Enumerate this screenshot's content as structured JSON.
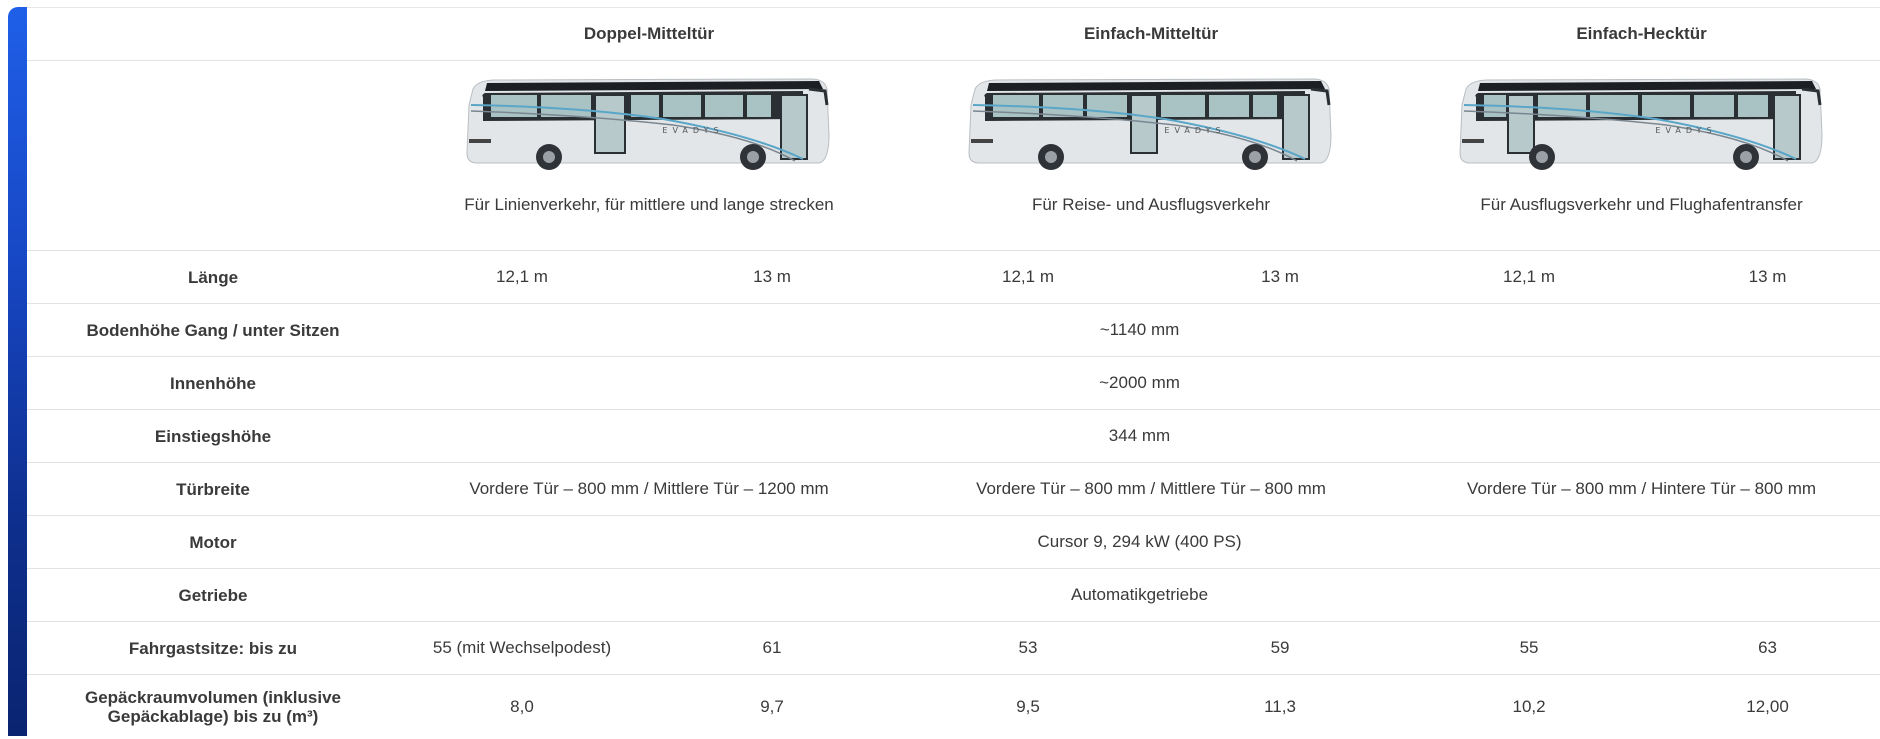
{
  "header": {
    "columns": [
      "Doppel-Mitteltür",
      "Einfach-Mitteltür",
      "Einfach-Hecktür"
    ]
  },
  "buses": [
    {
      "brand": "EVADYS",
      "description": "Für Linienverkehr, für mittlere und lange strecken",
      "icon": "bus-image"
    },
    {
      "brand": "EVADYS",
      "description": "Für Reise- und Ausflugsverkehr",
      "icon": "bus-image"
    },
    {
      "brand": "EVADYS",
      "description": "Für Ausflugsverkehr und Flughafentransfer",
      "icon": "bus-image"
    }
  ],
  "rows": {
    "laenge": {
      "label": "Länge",
      "values": [
        "12,1 m",
        "13 m",
        "12,1 m",
        "13 m",
        "12,1 m",
        "13 m"
      ]
    },
    "bodenhoehe": {
      "label": "Bodenhöhe Gang / unter Sitzen",
      "value": "~1140 mm"
    },
    "innenhoehe": {
      "label": "Innenhöhe",
      "value": "~2000 mm"
    },
    "einstiegshoehe": {
      "label": "Einstiegshöhe",
      "value": "344 mm"
    },
    "tuerbreite": {
      "label": "Türbreite",
      "values": [
        "Vordere Tür – 800 mm / Mittlere Tür – 1200 mm",
        "Vordere Tür – 800 mm / Mittlere Tür – 800 mm",
        "Vordere Tür – 800 mm / Hintere Tür – 800 mm"
      ]
    },
    "motor": {
      "label": "Motor",
      "value": "Cursor 9, 294 kW (400 PS)"
    },
    "getriebe": {
      "label": "Getriebe",
      "value": "Automatikgetriebe"
    },
    "fahrgastsitze": {
      "label": "Fahrgastsitze: bis zu",
      "values": [
        "55 (mit Wechselpodest)",
        "61",
        "53",
        "59",
        "55",
        "63"
      ]
    },
    "gepaeck": {
      "label_line1": "Gepäckraumvolumen (inklusive",
      "label_line2": "Gepäckablage) bis zu (m³)",
      "values": [
        "8,0",
        "9,7",
        "9,5",
        "11,3",
        "10,2",
        "12,00"
      ]
    }
  },
  "colors": {
    "accent": "#1d55d6",
    "bar_top": "#1f5fe8",
    "bar_bottom": "#0a2470",
    "border": "#e2e2e2"
  }
}
